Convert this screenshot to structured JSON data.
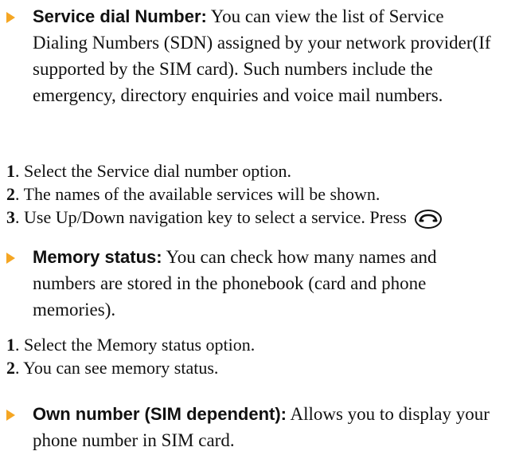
{
  "sections": [
    {
      "heading": "Service dial Number:",
      "text": "You can view the list of Service Dialing Numbers (SDN) assigned by your network provider(If supported by the SIM card). Such numbers include the emergency, directory enquiries and voice mail numbers.",
      "steps": [
        {
          "num": "1",
          "text": ". Select the Service dial number option."
        },
        {
          "num": "2",
          "text": ". The names of the available services will be shown."
        },
        {
          "num": "3",
          "text": ". Use Up/Down navigation key to select a service. Press",
          "icon": "send-key-icon"
        }
      ]
    },
    {
      "heading": "Memory status:",
      "text": "You can check how many names and numbers are stored in the phonebook (card and phone memories).",
      "steps": [
        {
          "num": "1",
          "text": ". Select the Memory status option."
        },
        {
          "num": "2",
          "text": ". You can see memory status."
        }
      ]
    },
    {
      "heading": "Own number (SIM dependent):",
      "text": "Allows you to display your phone number in SIM card."
    }
  ],
  "colors": {
    "bullet": "#f5a623",
    "text": "#111111"
  }
}
